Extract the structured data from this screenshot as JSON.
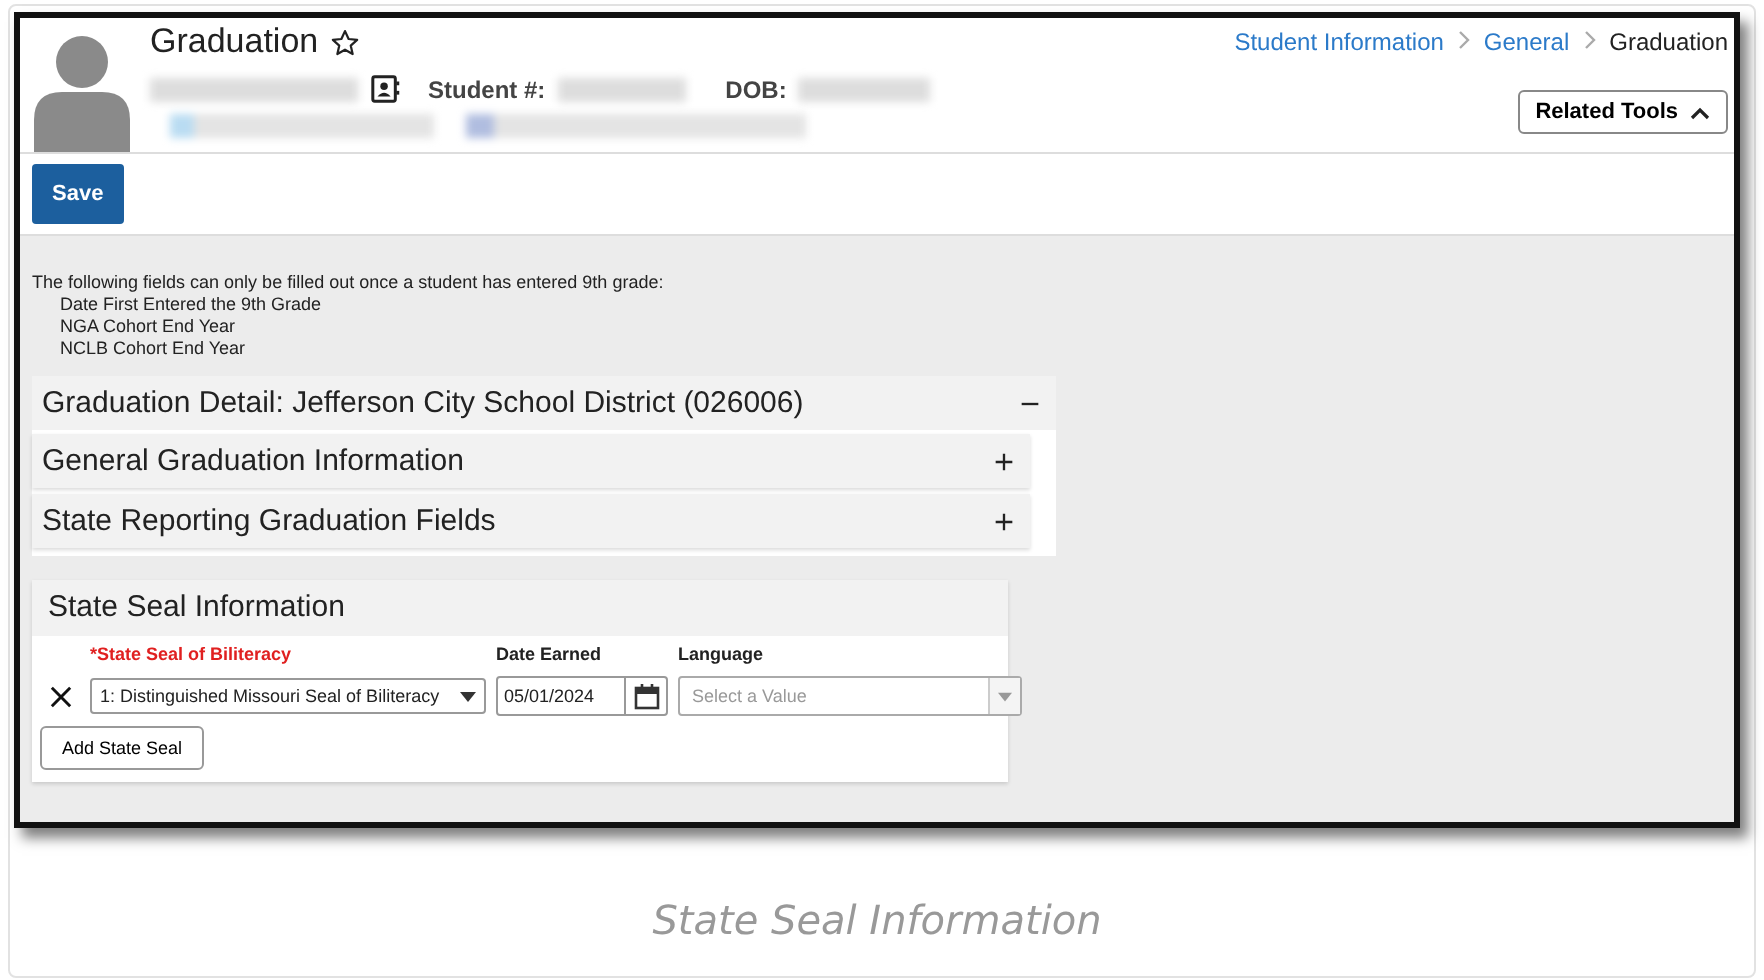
{
  "header": {
    "title": "Graduation",
    "favorite": false,
    "student_number_label": "Student #:",
    "dob_label": "DOB:"
  },
  "breadcrumb": [
    {
      "label": "Student Information",
      "current": false
    },
    {
      "label": "General",
      "current": false
    },
    {
      "label": "Graduation",
      "current": true
    }
  ],
  "related_tools": {
    "label": "Related Tools",
    "expanded": true
  },
  "toolbar": {
    "save": "Save"
  },
  "notice": {
    "intro": "The following fields can only be filled out once a student has entered 9th grade:",
    "fields": [
      "Date First Entered the 9th Grade",
      "NGA Cohort End Year",
      "NCLB Cohort End Year"
    ]
  },
  "detail": {
    "title": "Graduation Detail: Jefferson City School District (026006)",
    "expanded": true,
    "children": [
      {
        "title": "General Graduation Information",
        "expanded": false
      },
      {
        "title": "State Reporting Graduation Fields",
        "expanded": false
      }
    ]
  },
  "state_seal": {
    "title": "State Seal Information",
    "columns": [
      {
        "label": "*State Seal of Biliteracy",
        "required": true
      },
      {
        "label": "Date Earned",
        "required": false
      },
      {
        "label": "Language",
        "required": false
      }
    ],
    "rows": [
      {
        "seal": "1: Distinguished Missouri Seal of Biliteracy",
        "date": "05/01/2024",
        "language_placeholder": "Select a Value"
      }
    ],
    "add_button": "Add State Seal"
  },
  "caption": "State Seal Information"
}
